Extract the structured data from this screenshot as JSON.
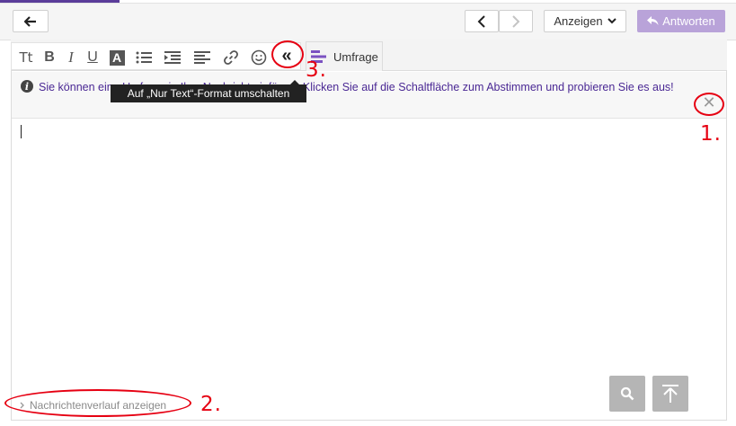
{
  "header": {
    "show_label": "Anzeigen",
    "reply_label": "Antworten"
  },
  "format_toolbar": {
    "text_size_label": "Tt",
    "bold_label": "B",
    "italic_label": "I",
    "underline_label": "U",
    "color_label": "A",
    "plain_text_toggle_label": "«",
    "poll_label": "Umfrage"
  },
  "tooltip": {
    "text": "Auf „Nur Text“-Format umschalten"
  },
  "info": {
    "text": "Sie können eine Umfrage in Ihre Nachricht einfügen. Klicken Sie auf die Schaltfläche zum Abstimmen und probieren Sie es aus!"
  },
  "history": {
    "label": "Nachrichtenverlauf anzeigen"
  },
  "annotations": {
    "one": "1.",
    "two": "2.",
    "three": "3."
  },
  "colors": {
    "accent": "#5b3d9a",
    "reply_button": "#b9a3d9",
    "info_text": "#4a2894",
    "annotation_red": "#e60012"
  }
}
